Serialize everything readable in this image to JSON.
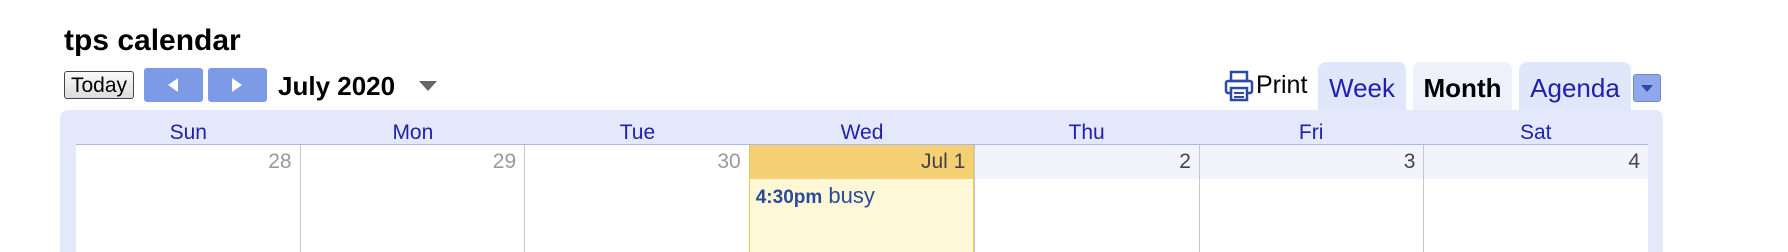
{
  "calendar": {
    "title": "tps calendar",
    "current_period": "July 2020"
  },
  "toolbar": {
    "today_label": "Today",
    "prev_icon": "chevron-left-icon",
    "next_icon": "chevron-right-icon",
    "print_label": "Print",
    "print_icon": "printer-icon"
  },
  "views": {
    "tabs": [
      {
        "label": "Week",
        "selected": false
      },
      {
        "label": "Month",
        "selected": true
      },
      {
        "label": "Agenda",
        "selected": false
      }
    ]
  },
  "grid": {
    "weekdays": [
      "Sun",
      "Mon",
      "Tue",
      "Wed",
      "Thu",
      "Fri",
      "Sat"
    ],
    "days": [
      {
        "label": "28",
        "state": "prev"
      },
      {
        "label": "29",
        "state": "prev"
      },
      {
        "label": "30",
        "state": "prev"
      },
      {
        "label": "Jul 1",
        "state": "today"
      },
      {
        "label": "2",
        "state": "cur"
      },
      {
        "label": "3",
        "state": "cur"
      },
      {
        "label": "4",
        "state": "cur"
      }
    ]
  },
  "events": [
    {
      "time": "4:30pm",
      "title": "busy",
      "day": "Jul 1"
    }
  ],
  "colors": {
    "accent": "#2020b0",
    "nav_button": "#7d9ae6",
    "today_header": "#f5cf74",
    "today_background": "#fff8d6",
    "event_text": "#2a4a9a"
  }
}
